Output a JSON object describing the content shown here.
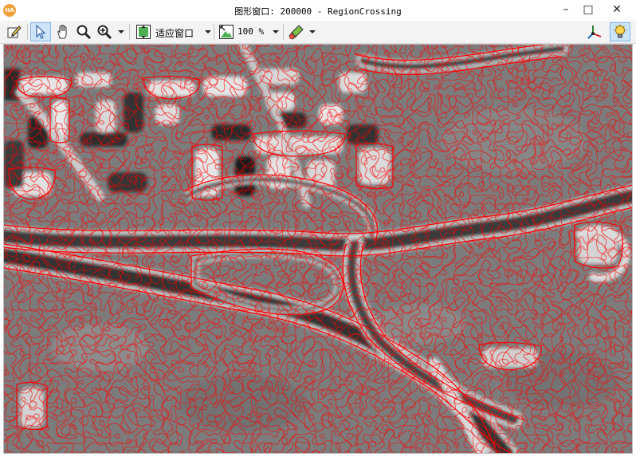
{
  "window": {
    "app_icon_text": "HA",
    "title": "图形窗口: 200000 - RegionCrossing",
    "minimize_glyph": "–",
    "maximize_glyph": "□",
    "close_glyph": "✕"
  },
  "toolbar": {
    "fit_window_label": "适应窗口",
    "zoom_value": "100 %",
    "items": [
      {
        "name": "edit-settings-icon"
      },
      {
        "name": "pointer-icon",
        "active": true
      },
      {
        "name": "hand-pan-icon"
      },
      {
        "name": "magnifier-icon"
      },
      {
        "name": "zoom-in-icon"
      },
      {
        "name": "fit-window-icon"
      },
      {
        "name": "zoom-display-icon"
      },
      {
        "name": "draw-color-icon"
      },
      {
        "name": "3d-axes-icon"
      },
      {
        "name": "light-bulb-icon"
      }
    ]
  },
  "canvas": {
    "description_colors": {
      "background": "#7a7a7a",
      "dark_structures": "#1e1e1e",
      "light_structures": "#e8e8e8",
      "region_contours": "#ff0000"
    }
  }
}
